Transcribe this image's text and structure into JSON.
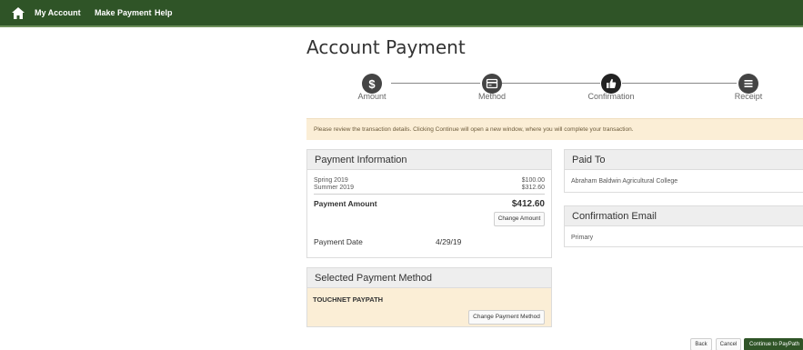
{
  "nav": {
    "items": [
      "My Account",
      "Make Payment",
      "Help"
    ]
  },
  "page": {
    "title": "Account Payment"
  },
  "steps": [
    {
      "label": "Amount",
      "icon": "dollar-icon",
      "state": "complete"
    },
    {
      "label": "Method",
      "icon": "credit-card-icon",
      "state": "complete"
    },
    {
      "label": "Confirmation",
      "icon": "thumbs-up-icon",
      "state": "current"
    },
    {
      "label": "Receipt",
      "icon": "list-icon",
      "state": "upcoming"
    }
  ],
  "notice": {
    "text": "Please review the transaction details. Clicking Continue will open a new window, where you will complete your transaction."
  },
  "payment_info": {
    "title": "Payment Information",
    "items": [
      {
        "term": "Spring 2019",
        "amount": "$100.00"
      },
      {
        "term": "Summer 2019",
        "amount": "$312.60"
      }
    ],
    "amount_label": "Payment Amount",
    "amount_value": "$412.60",
    "change_amount_label": "Change Amount",
    "date_label": "Payment Date",
    "date_value": "4/29/19"
  },
  "selected_method": {
    "title": "Selected Payment Method",
    "method": "TOUCHNET PAYPATH",
    "change_label": "Change Payment Method"
  },
  "paid_to": {
    "title": "Paid To",
    "name": "Abraham Baldwin Agricultural College"
  },
  "confirmation_email": {
    "title": "Confirmation Email",
    "primary_label": "Primary"
  },
  "actions": {
    "back": "Back",
    "cancel": "Cancel",
    "continue": "Continue to PayPath"
  },
  "colors": {
    "nav_bg": "#2f5427",
    "notice_bg": "#fbeed6",
    "step_circle": "#444444",
    "primary_button": "#2f5427"
  }
}
